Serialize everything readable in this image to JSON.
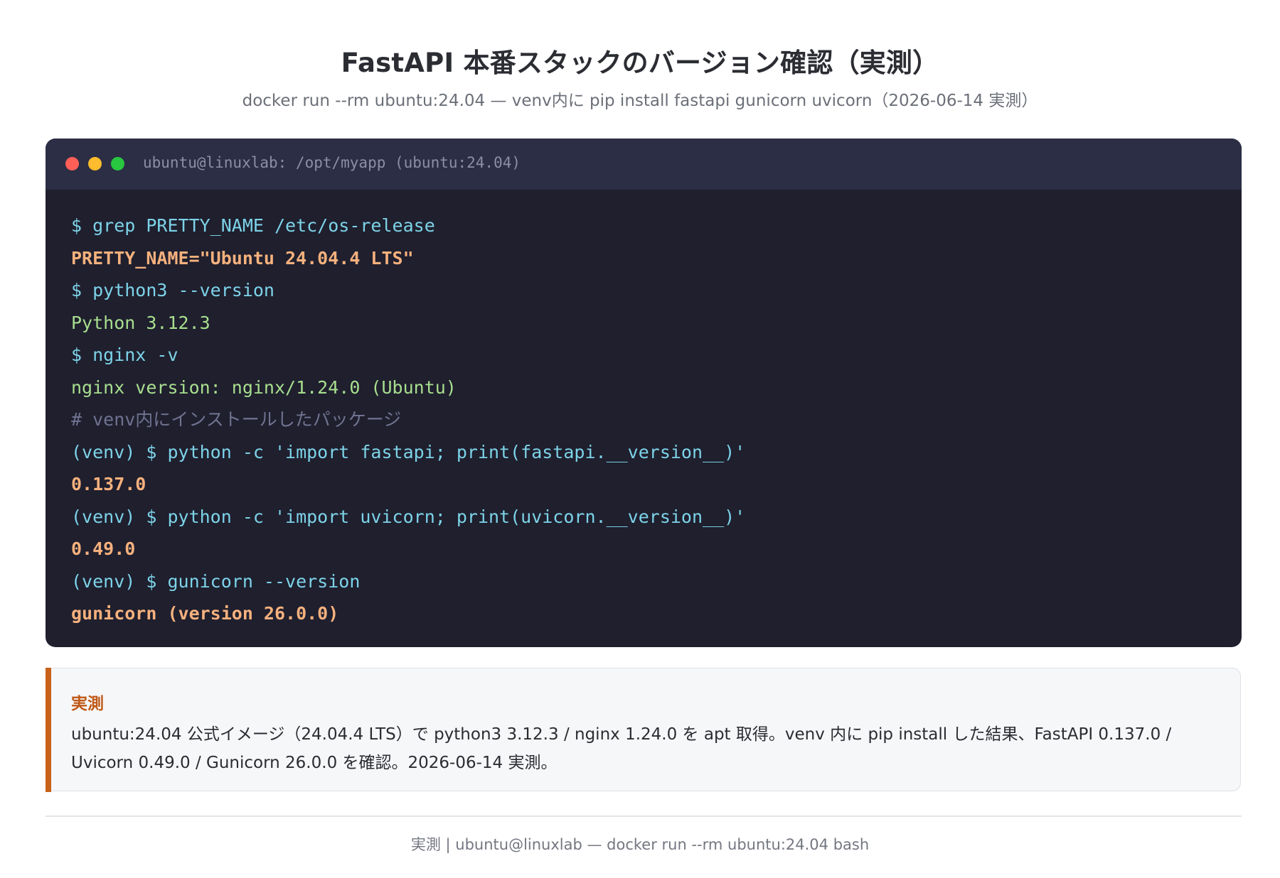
{
  "header": {
    "title": "FastAPI 本番スタックのバージョン確認（実測）",
    "subtitle": "docker run --rm ubuntu:24.04 — venv内に pip install fastapi gunicorn uvicorn（2026-06-14 実測）"
  },
  "terminal": {
    "title": "ubuntu@linuxlab: /opt/myapp (ubuntu:24.04)",
    "lines": [
      {
        "text": "$ grep PRETTY_NAME /etc/os-release",
        "kind": "cmd"
      },
      {
        "text": "PRETTY_NAME=\"Ubuntu 24.04.4 LTS\"",
        "kind": "bold"
      },
      {
        "text": "$ python3 --version",
        "kind": "cmd"
      },
      {
        "text": "Python 3.12.3",
        "kind": "out"
      },
      {
        "text": "$ nginx -v",
        "kind": "cmd"
      },
      {
        "text": "nginx version: nginx/1.24.0 (Ubuntu)",
        "kind": "out"
      },
      {
        "text": "# venv内にインストールしたパッケージ",
        "kind": "cmt"
      },
      {
        "text": "(venv) $ python -c 'import fastapi; print(fastapi.__version__)'",
        "kind": "cmd"
      },
      {
        "text": "0.137.0",
        "kind": "bold"
      },
      {
        "text": "(venv) $ python -c 'import uvicorn; print(uvicorn.__version__)'",
        "kind": "cmd"
      },
      {
        "text": "0.49.0",
        "kind": "bold"
      },
      {
        "text": "(venv) $ gunicorn --version",
        "kind": "cmd"
      },
      {
        "text": "gunicorn (version 26.0.0)",
        "kind": "bold"
      }
    ]
  },
  "callout": {
    "title": "実測",
    "text": "ubuntu:24.04 公式イメージ（24.04.4 LTS）で python3 3.12.3 / nginx 1.24.0 を apt 取得。venv 内に pip install した結果、FastAPI 0.137.0 / Uvicorn 0.49.0 / Gunicorn 26.0.0 を確認。2026-06-14 実測。"
  },
  "footer": {
    "text": "実測 | ubuntu@linuxlab — docker run --rm ubuntu:24.04 bash"
  },
  "colors": {
    "terminal_bg": "#1f1f2e",
    "terminal_bar": "#2c2e45",
    "command": "#7dd3e8",
    "output_highlight": "#f6b17d",
    "output": "#a8df8e",
    "comment": "#6f7390",
    "accent": "#c8621a"
  }
}
